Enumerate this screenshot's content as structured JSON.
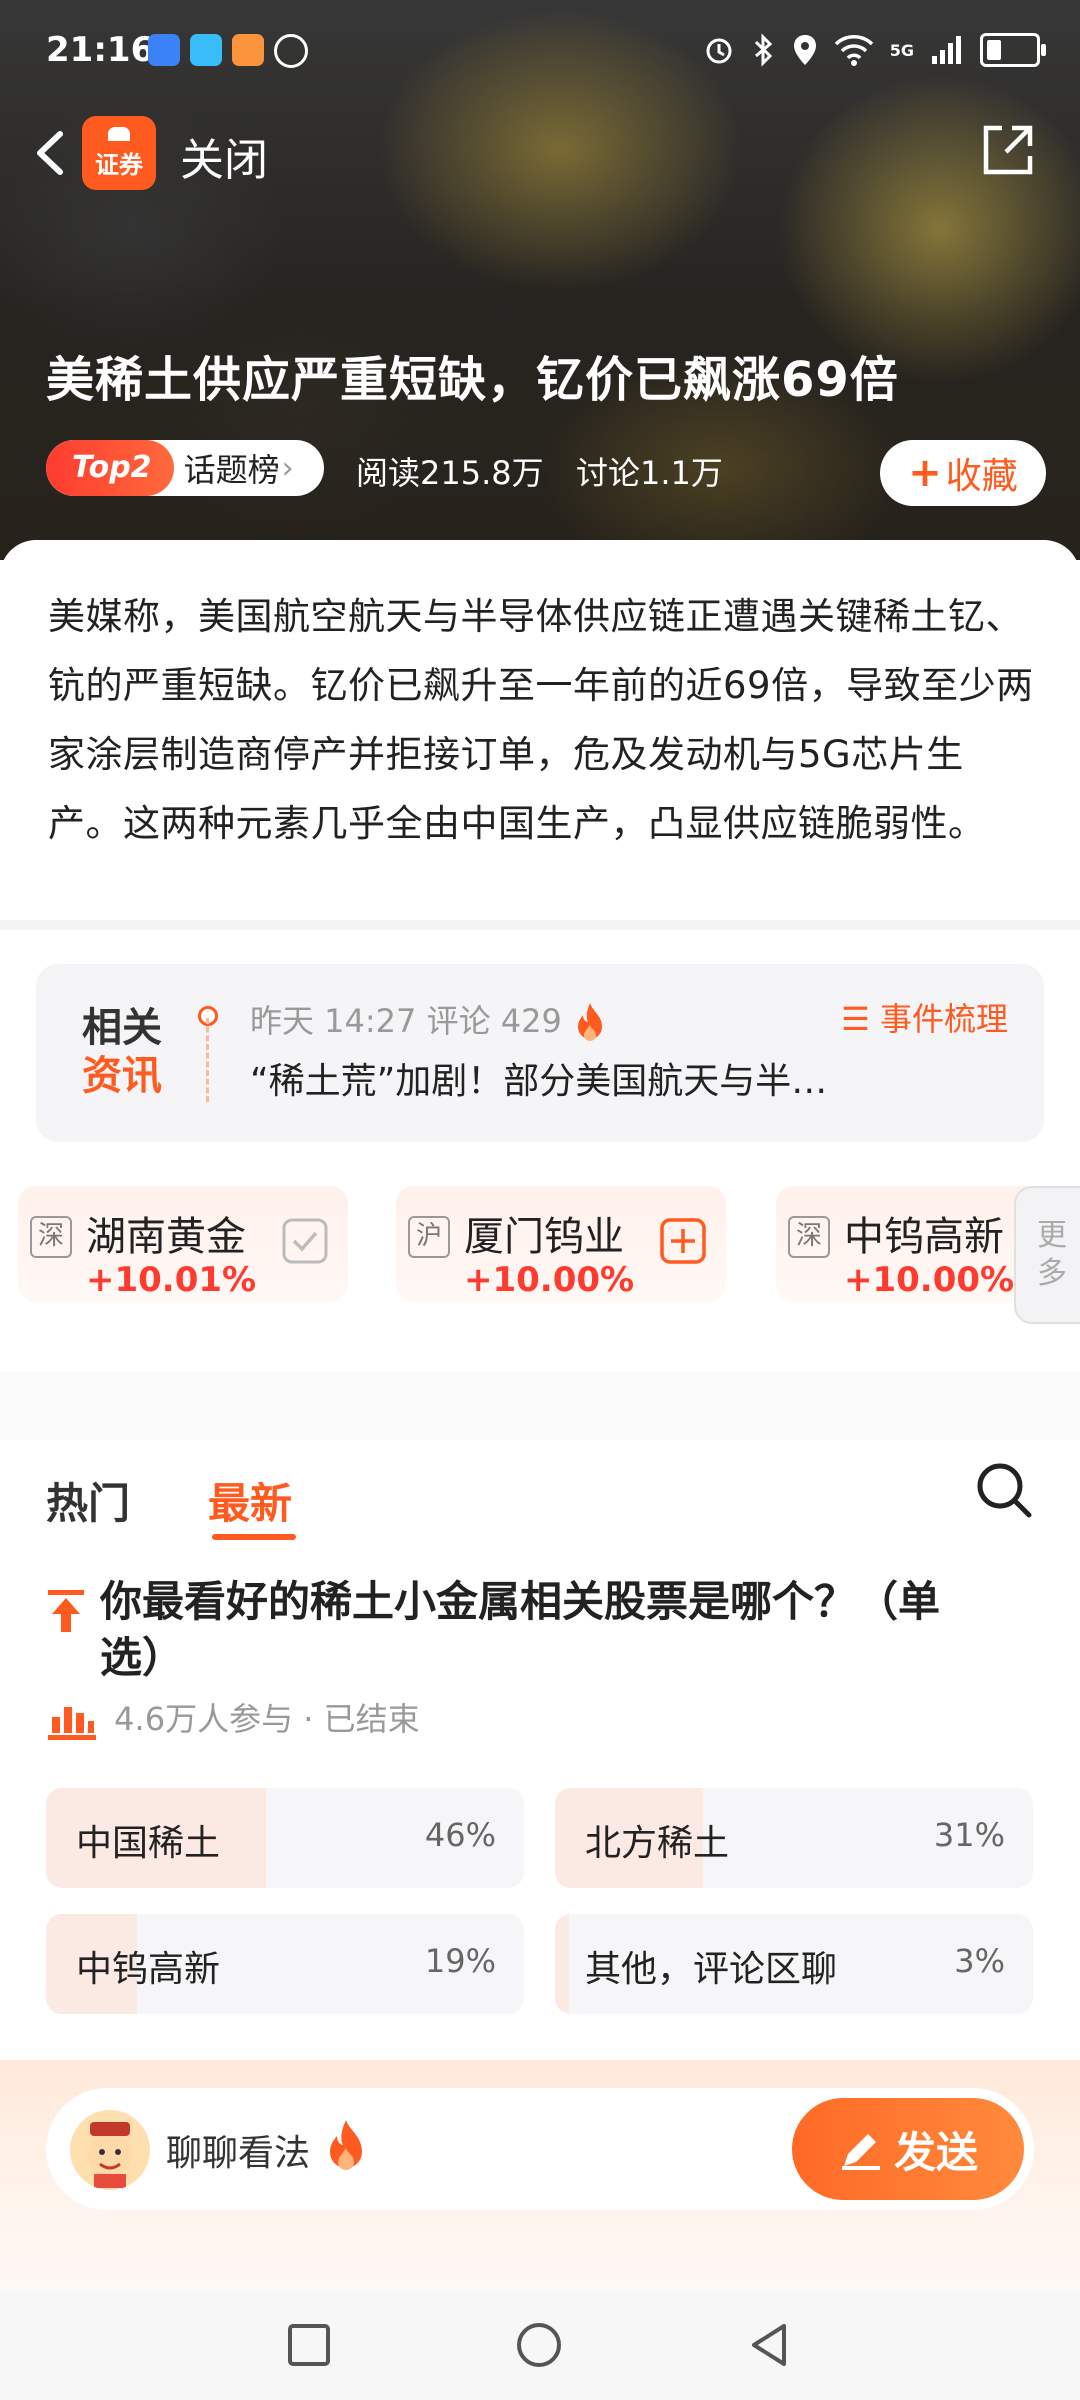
{
  "status_bar": {
    "time": "21:16",
    "network": "5G"
  },
  "nav": {
    "brand_label": "证券",
    "close_label": "关闭"
  },
  "headline": "美稀土供应严重短缺，钇价已飙涨69倍",
  "meta": {
    "rank_badge": "Top2",
    "rank_label": "话题榜",
    "reads": "阅读215.8万",
    "discussions": "讨论1.1万",
    "favorite_label": "收藏"
  },
  "summary": "美媒称，美国航空航天与半导体供应链正遭遇关键稀土钇、钪的严重短缺。钇价已飙升至一年前的近69倍，导致至少两家涂层制造商停产并拒接订单，危及发动机与5G芯片生产。这两种元素几乎全由中国生产，凸显供应链脆弱性。",
  "related_news": {
    "tag_line1": "相关",
    "tag_line2": "资讯",
    "meta": "昨天 14:27 评论 429",
    "event_link": "事件梳理",
    "title": "“稀土荒”加剧！部分美国航天与半…"
  },
  "stocks": [
    {
      "exchange": "深",
      "name": "湖南黄金",
      "change": "+10.01%",
      "added": true
    },
    {
      "exchange": "沪",
      "name": "厦门钨业",
      "change": "+10.00%",
      "added": false
    },
    {
      "exchange": "深",
      "name": "中钨高新",
      "change": "+10.00%",
      "added": false
    }
  ],
  "more_label_1": "更",
  "more_label_2": "多",
  "tabs": {
    "hot": "热门",
    "latest": "最新"
  },
  "poll": {
    "question": "你最看好的稀土小金属相关股票是哪个？（单选）",
    "participants": "4.6万人参与",
    "status": "· 已结束",
    "options": [
      {
        "label": "中国稀土",
        "percent": "46%",
        "share": 0.46
      },
      {
        "label": "北方稀土",
        "percent": "31%",
        "share": 0.31
      },
      {
        "label": "中钨高新",
        "percent": "19%",
        "share": 0.19
      },
      {
        "label": "其他，评论区聊",
        "percent": "3%",
        "share": 0.03
      }
    ]
  },
  "comment": {
    "placeholder": "聊聊看法",
    "send_label": "发送"
  },
  "colors": {
    "accent": "#ff5a1f",
    "up_red": "#ff3b2f",
    "poll_fill": "#fbe9e4"
  }
}
